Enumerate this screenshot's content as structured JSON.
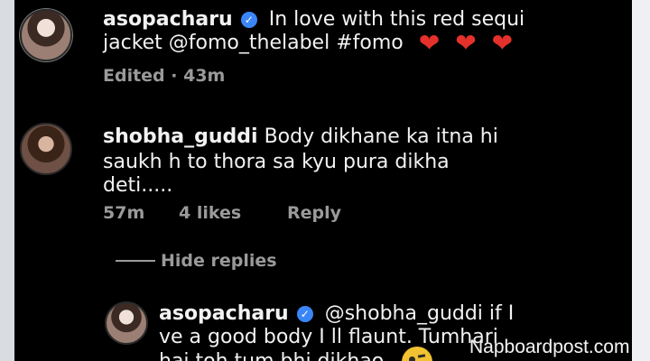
{
  "post": {
    "username": "asopacharu",
    "caption_line1": "In love with this red sequi",
    "caption_line2": "jacket @fomo_thelabel  #fomo",
    "meta": "Edited · 43m"
  },
  "comment": {
    "username": "shobha_guddi",
    "text_line1": "Body dikhane ka itna hi",
    "text_line2": "saukh h to thora sa kyu pura dikha",
    "text_line3": "deti.....",
    "time": "57m",
    "likes": "4 likes",
    "reply_label": "Reply"
  },
  "replies": {
    "hide_label": "Hide replies"
  },
  "reply": {
    "username": "asopacharu",
    "text_line1": "@shobha_guddi if I",
    "text_line2": "ve a good body I ll flaunt. Tumhari",
    "text_line3": "hai toh tum bhi dikhao."
  },
  "watermark": "Napboardpost.com",
  "colors": {
    "background": "#000000",
    "text": "#f2f2f2",
    "muted": "#9a9a9a",
    "verified": "#3b86f7",
    "heart": "#e5312b"
  },
  "icons": [
    "verified-badge-icon",
    "heart-icon",
    "smile-emoji-icon"
  ]
}
